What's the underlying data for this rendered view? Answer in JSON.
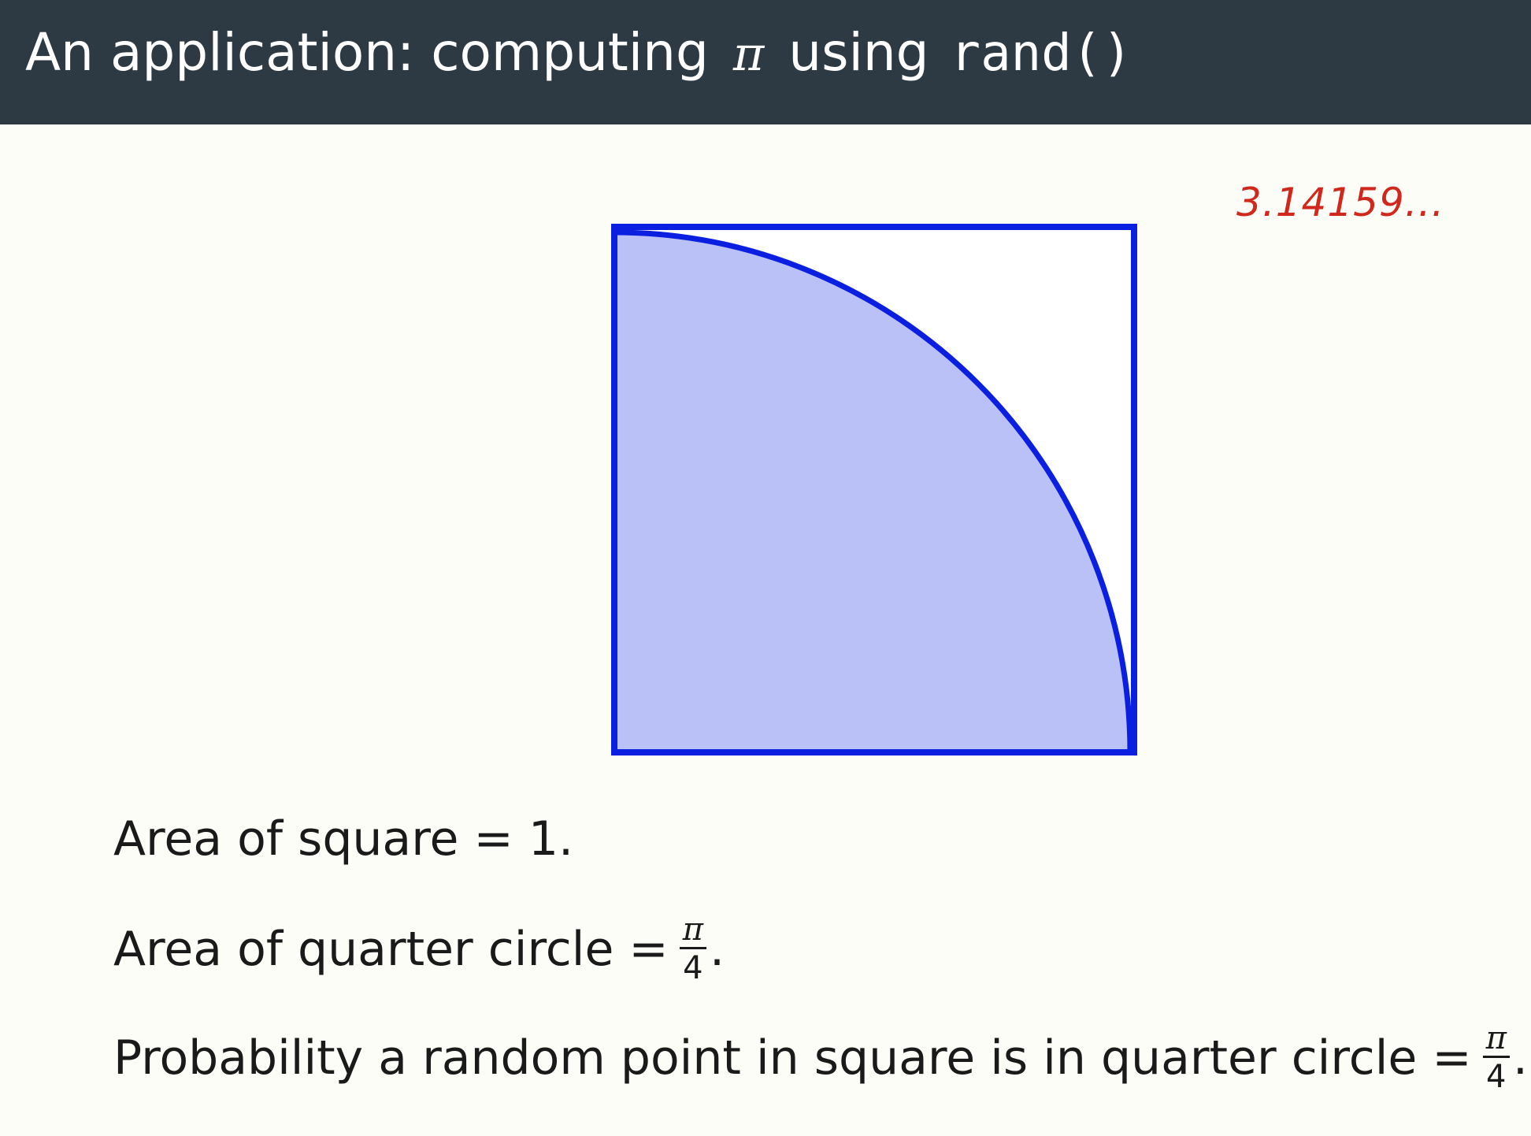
{
  "header": {
    "title_text": "An application: computing",
    "title_pi": "π",
    "title_mid": "using",
    "title_code": "rand()"
  },
  "annotation": {
    "handwritten": "3.14159..."
  },
  "figure": {
    "square_side": 1,
    "quarter_circle_fraction_of_square": 0.785,
    "colors": {
      "stroke": "#0b1fe0",
      "fill": "#bac1f7",
      "square_bg": "#ffffff"
    }
  },
  "lines": [
    {
      "text": "Area of square = 1."
    },
    {
      "text": "Area of quarter circle =",
      "frac_num": "π",
      "frac_den": "4",
      "end": "."
    },
    {
      "text": "Probability a random point in square is in quarter circle =",
      "frac_num": "π",
      "frac_den": "4",
      "end": "."
    }
  ]
}
